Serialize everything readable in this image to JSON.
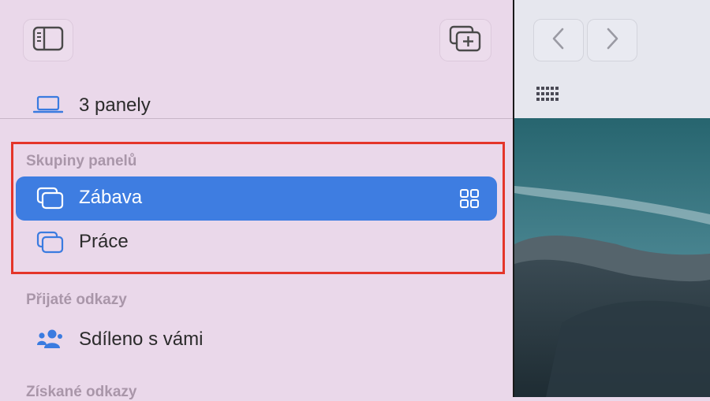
{
  "sidebar": {
    "device_row": {
      "label": "3 panely",
      "icon": "laptop-icon"
    },
    "tab_groups_section": {
      "heading": "Skupiny panelů",
      "items": [
        {
          "label": "Zábava",
          "icon": "tab-group-icon",
          "selected": true,
          "trailing_icon": "grid-overview-icon"
        },
        {
          "label": "Práce",
          "icon": "tab-group-icon",
          "selected": false
        }
      ]
    },
    "received_links_section": {
      "heading": "Přijaté odkazy",
      "items": [
        {
          "label": "Sdíleno s vámi",
          "icon": "shared-people-icon"
        }
      ]
    },
    "obtained_links_section": {
      "heading": "Získané odkazy"
    }
  },
  "browser": {
    "nav": {
      "back_icon": "chevron-left-icon",
      "forward_icon": "chevron-right-icon"
    },
    "tab_overview_icon": "dots-grid-icon"
  },
  "colors": {
    "sidebar_bg": "#ead8ea",
    "selection": "#3e7de1",
    "accent_icon": "#3a7be0",
    "highlight_border": "#e4352a",
    "section_heading": "#a996a9"
  }
}
